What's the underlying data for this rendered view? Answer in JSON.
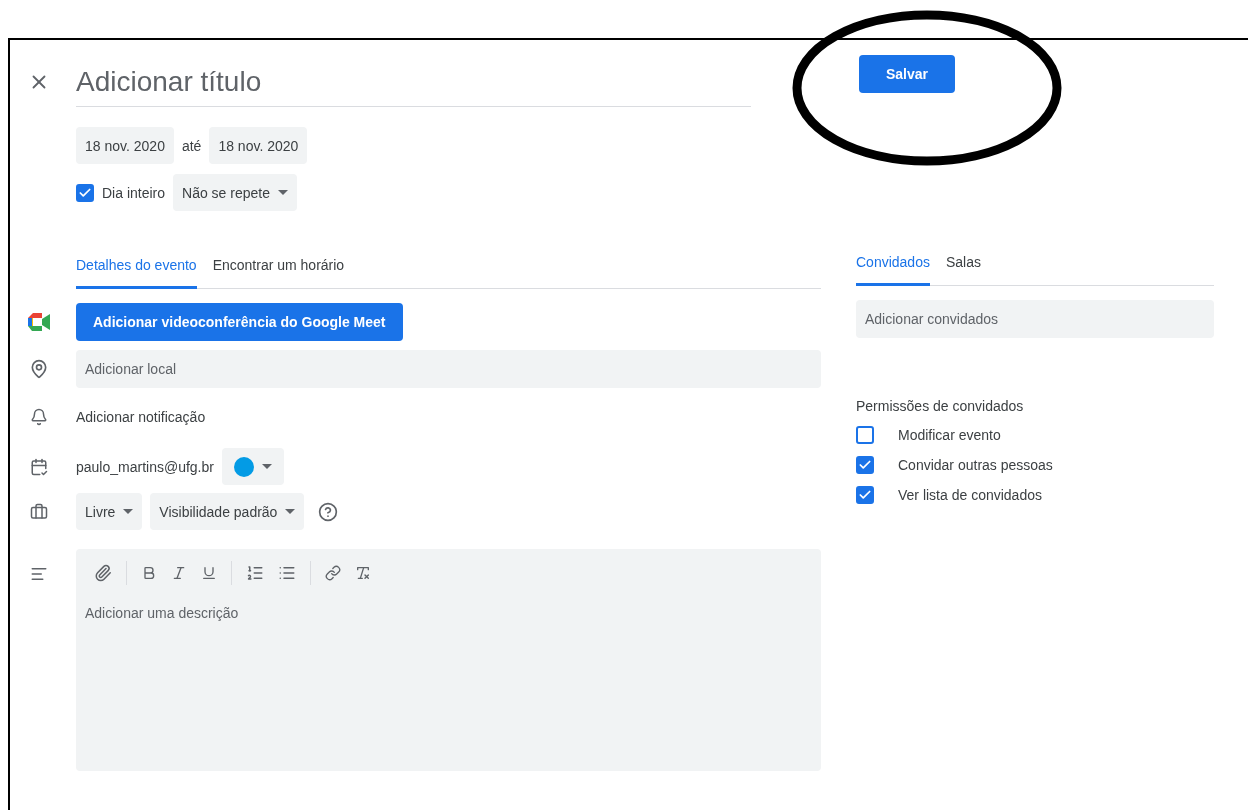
{
  "title": {
    "placeholder": "Adicionar título"
  },
  "save_button": "Salvar",
  "dates": {
    "start": "18 nov. 2020",
    "separator": "até",
    "end": "18 nov. 2020"
  },
  "all_day": {
    "label": "Dia inteiro",
    "checked": true
  },
  "repeat": "Não se repete",
  "tabs": [
    {
      "label": "Detalhes do evento",
      "selected": true
    },
    {
      "label": "Encontrar um horário",
      "selected": false
    }
  ],
  "meet_button": "Adicionar videoconferência do Google Meet",
  "location": {
    "placeholder": "Adicionar local"
  },
  "notification": "Adicionar notificação",
  "calendar": {
    "owner": "paulo_martins@ufg.br",
    "color": "#039be5"
  },
  "availability": "Livre",
  "visibility": "Visibilidade padrão",
  "description": {
    "placeholder": "Adicionar uma descrição"
  },
  "guest_tabs": [
    {
      "label": "Convidados",
      "selected": true
    },
    {
      "label": "Salas",
      "selected": false
    }
  ],
  "guests": {
    "placeholder": "Adicionar convidados"
  },
  "permissions": {
    "title": "Permissões de convidados",
    "items": [
      {
        "label": "Modificar evento",
        "checked": false
      },
      {
        "label": "Convidar outras pessoas",
        "checked": true
      },
      {
        "label": "Ver lista de convidados",
        "checked": true
      }
    ]
  }
}
